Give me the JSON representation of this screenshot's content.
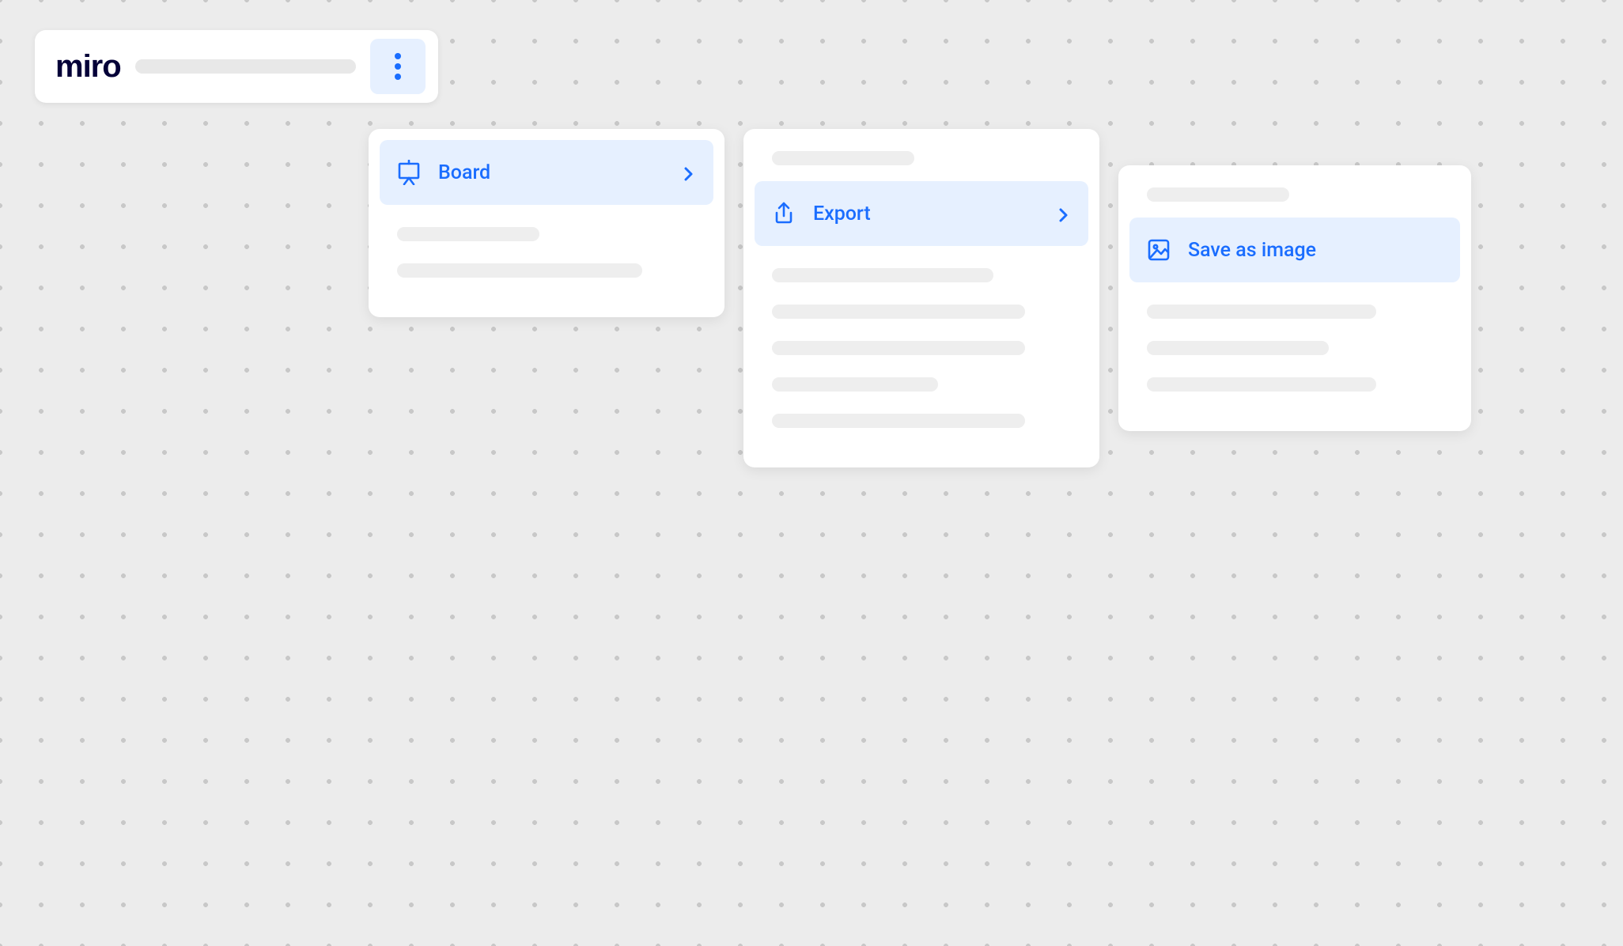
{
  "app": {
    "logo_text": "miro"
  },
  "colors": {
    "accent": "#1a6dff",
    "highlight_bg": "#e6f0ff"
  },
  "menu1": {
    "items": [
      {
        "icon": "board-easel-icon",
        "label": "Board",
        "has_submenu": true,
        "highlighted": true
      }
    ]
  },
  "menu2": {
    "items": [
      {
        "icon": "export-upload-icon",
        "label": "Export",
        "has_submenu": true,
        "highlighted": true
      }
    ]
  },
  "menu3": {
    "items": [
      {
        "icon": "image-icon",
        "label": "Save as image",
        "has_submenu": false,
        "highlighted": true
      }
    ]
  }
}
